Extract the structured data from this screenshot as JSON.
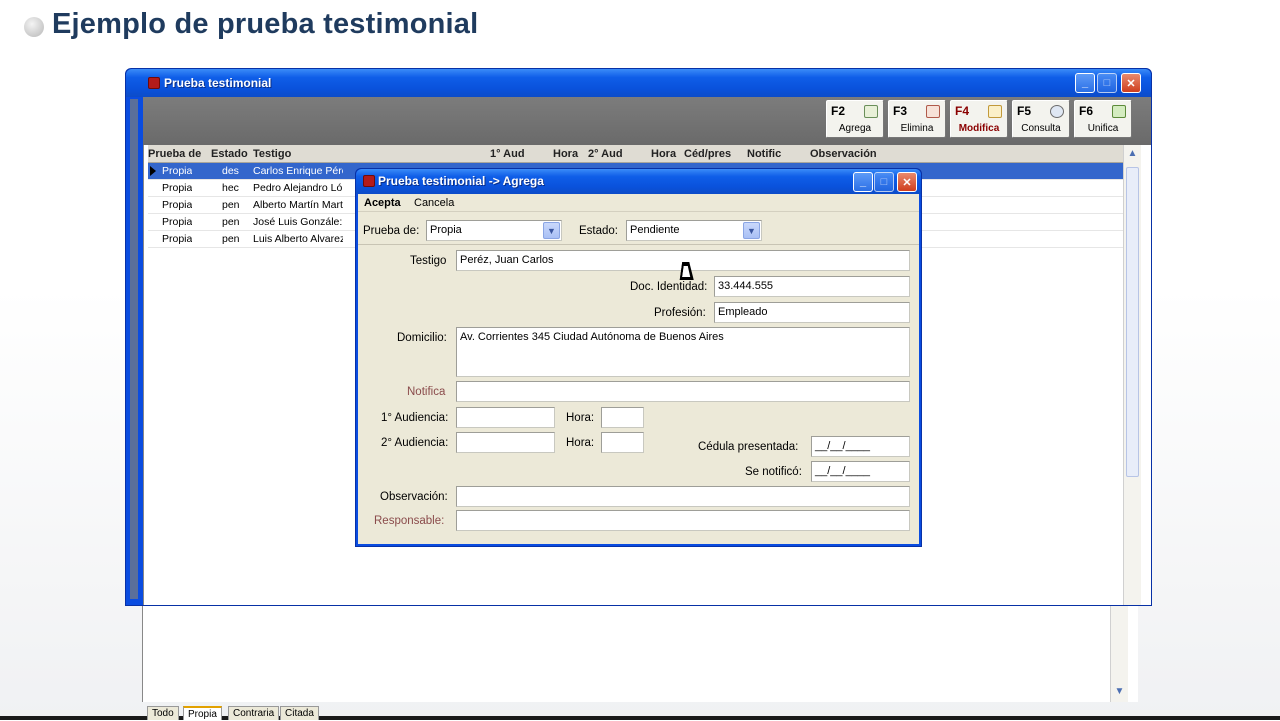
{
  "slide": {
    "title": "Ejemplo de prueba testimonial"
  },
  "main_window": {
    "title": "Prueba testimonial",
    "toolbar": [
      {
        "key": "F2",
        "label": "Agrega",
        "active": false
      },
      {
        "key": "F3",
        "label": "Elimina",
        "active": false
      },
      {
        "key": "F4",
        "label": "Modifica",
        "active": true
      },
      {
        "key": "F5",
        "label": "Consulta",
        "active": false
      },
      {
        "key": "F6",
        "label": "Unifica",
        "active": false
      }
    ],
    "grid": {
      "columns": [
        "Prueba de",
        "Estado",
        "Testigo",
        "1° Aud",
        "Hora",
        "2° Aud",
        "Hora",
        "Céd/pres",
        "Notific",
        "Observación"
      ],
      "rows": [
        {
          "prueba": "Propia",
          "estado": "des",
          "testigo": "Carlos Enrique Pére",
          "selected": true
        },
        {
          "prueba": "Propia",
          "estado": "hec",
          "testigo": "Pedro Alejandro Ló",
          "selected": false
        },
        {
          "prueba": "Propia",
          "estado": "pen",
          "testigo": "Alberto Martín Mart",
          "selected": false
        },
        {
          "prueba": "Propia",
          "estado": "pen",
          "testigo": "José Luis Gonzále:",
          "selected": false
        },
        {
          "prueba": "Propia",
          "estado": "pen",
          "testigo": "Luis Alberto Alvarez",
          "selected": false
        }
      ]
    },
    "tabs": [
      "Todo",
      "Propia",
      "Contraria",
      "Citada"
    ],
    "active_tab": "Propia"
  },
  "dialog": {
    "title": "Prueba testimonial -> Agrega",
    "menu": {
      "accept": "Acepta",
      "cancel": "Cancela"
    },
    "prueba_de": {
      "label": "Prueba de:",
      "value": "Propia"
    },
    "estado": {
      "label": "Estado:",
      "value": "Pendiente"
    },
    "testigo": {
      "label": "Testigo",
      "value": "Peréz, Juan Carlos"
    },
    "doc_identidad": {
      "label": "Doc. Identidad:",
      "value": "33.444.555"
    },
    "profesion": {
      "label": "Profesión:",
      "value": "Empleado"
    },
    "domicilio": {
      "label": "Domicilio:",
      "value": "Av. Corrientes 345 Ciudad Autónoma de Buenos Aires"
    },
    "notifica": {
      "label": "Notifica",
      "value": ""
    },
    "audiencia1": {
      "label": "1° Audiencia:",
      "value": ""
    },
    "hora1": {
      "label": "Hora:",
      "value": ""
    },
    "audiencia2": {
      "label": "2° Audiencia:",
      "value": ""
    },
    "hora2": {
      "label": "Hora:",
      "value": ""
    },
    "cedula": {
      "label": "Cédula presentada:",
      "value": "__/__/____"
    },
    "se_notifico": {
      "label": "Se notificó:",
      "value": "__/__/____"
    },
    "observacion": {
      "label": "Observación:",
      "value": ""
    },
    "responsable": {
      "label": "Responsable:",
      "value": ""
    }
  },
  "colors": {
    "title_text": "#1f3b5e",
    "xp_blue": "#0a52dc",
    "selection": "#3366cc",
    "accent_label": "#8a4b4b"
  }
}
